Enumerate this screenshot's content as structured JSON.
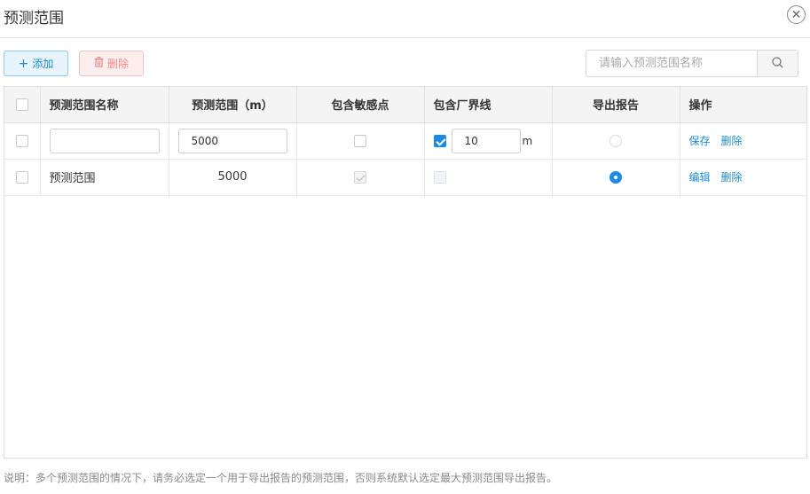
{
  "dialog": {
    "title": "预测范围",
    "close_icon": "close-circle-icon"
  },
  "toolbar": {
    "add_label": "添加",
    "add_icon": "plus-icon",
    "delete_label": "删除",
    "delete_icon": "trash-icon",
    "search_placeholder": "请输入预测范围名称",
    "search_icon": "search-icon"
  },
  "table": {
    "columns": [
      "预测范围名称",
      "预测范围（m）",
      "包含敏感点",
      "包含厂界线",
      "导出报告",
      "操作"
    ],
    "rows": [
      {
        "mode": "edit",
        "name": "",
        "range": "5000",
        "include_sensitive": false,
        "include_boundary": true,
        "boundary_value": "10",
        "boundary_unit": "m",
        "export_report": false,
        "actions": [
          "保存",
          "删除"
        ]
      },
      {
        "mode": "view",
        "name": "预测范围",
        "range": "5000",
        "include_sensitive": true,
        "include_boundary": false,
        "export_report": true,
        "actions": [
          "编辑",
          "删除"
        ]
      }
    ]
  },
  "footnote": "说明：多个预测范围的情况下，请务必选定一个用于导出报告的预测范围，否则系统默认选定最大预测范围导出报告。",
  "colors": {
    "accent": "#1e88e5",
    "danger": "#f08989",
    "header_bg": "#f4f4f4"
  }
}
